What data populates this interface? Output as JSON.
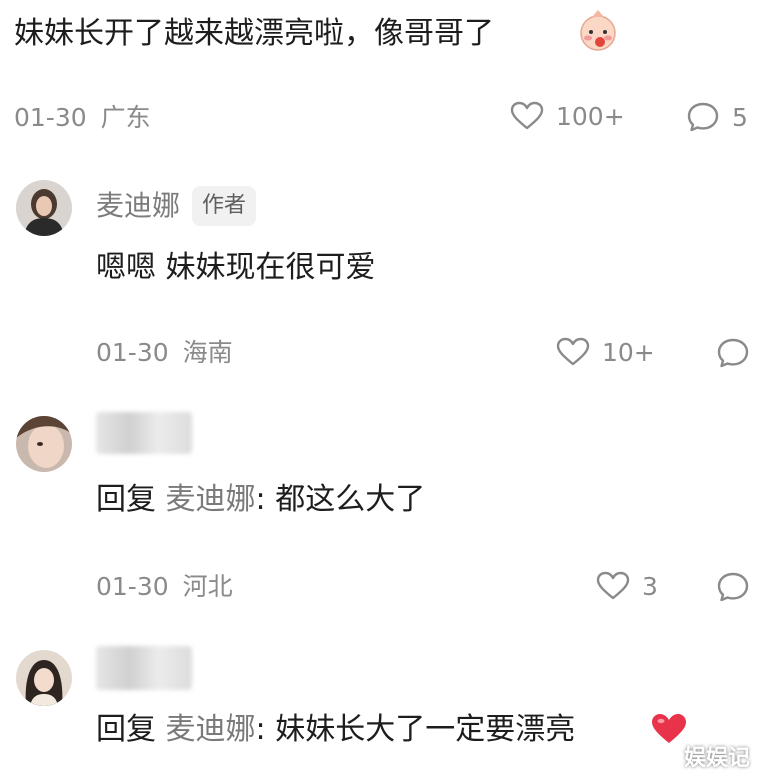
{
  "top_comment": {
    "text": "妹妹长开了越来越漂亮啦，像哥哥了",
    "emoji": "shy-baby-emoji",
    "date": "01-30",
    "location": "广东",
    "likes": "100+",
    "replies": "5"
  },
  "reply_1": {
    "user": "麦迪娜",
    "badge": "作者",
    "text": "嗯嗯 妹妹现在很可爱",
    "date": "01-30",
    "location": "海南",
    "likes": "10+"
  },
  "reply_2": {
    "prefix": "回复",
    "target": "麦迪娜",
    "text": ": 都这么大了",
    "date": "01-30",
    "location": "河北",
    "likes": "3"
  },
  "reply_3": {
    "prefix": "回复",
    "target": "麦迪娜",
    "text": ": 妹妹长大了一定要漂亮",
    "emoji": "red-heart-emoji"
  },
  "watermark": "娱娱记",
  "colors": {
    "muted": "#8a8a8a",
    "text": "#1d1d1d",
    "heart": "#e8334a"
  }
}
